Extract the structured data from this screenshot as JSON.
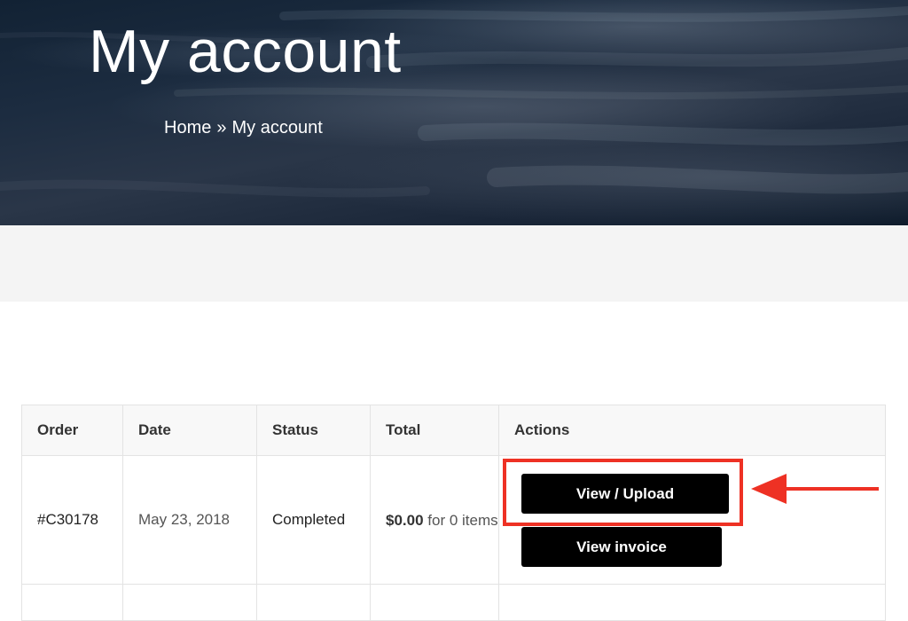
{
  "hero": {
    "title": "My account",
    "breadcrumb": {
      "home": "Home",
      "separator": "»",
      "current": "My account"
    }
  },
  "orders_table": {
    "headers": {
      "order": "Order",
      "date": "Date",
      "status": "Status",
      "total": "Total",
      "actions": "Actions"
    },
    "rows": [
      {
        "order": "#C30178",
        "date": "May 23, 2018",
        "status": "Completed",
        "total_amount": "$0.00",
        "total_suffix": "for 0 items",
        "actions": {
          "view_upload": "View / Upload",
          "view_invoice": "View invoice"
        }
      }
    ]
  },
  "annotation": {
    "highlight_color": "#ee3124",
    "icon": "arrow-left-icon"
  }
}
